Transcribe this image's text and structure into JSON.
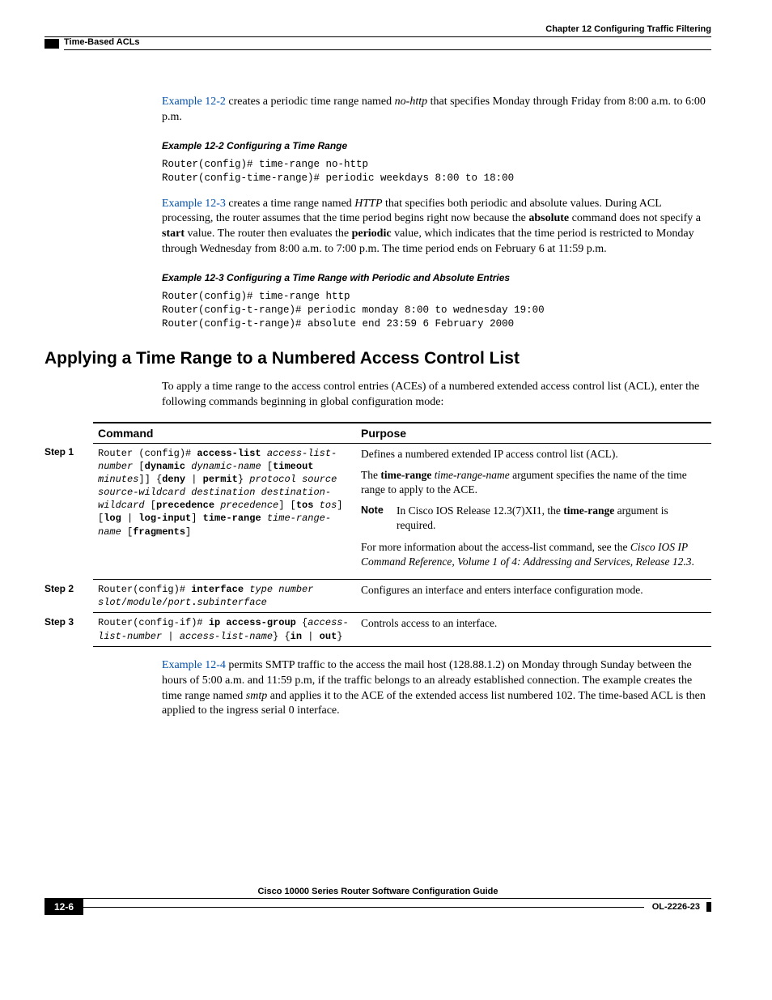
{
  "header": {
    "chapter": "Chapter 12    Configuring Traffic Filtering",
    "section": "Time-Based ACLs"
  },
  "p1": {
    "link": "Example 12-2",
    "rest_a": " creates a periodic time range named ",
    "italic": "no-http",
    "rest_b": " that specifies Monday through Friday from 8:00 a.m. to 6:00 p.m."
  },
  "ex2_title": "Example 12-2   Configuring a Time Range",
  "ex2_code": "Router(config)# time-range no-http\nRouter(config-time-range)# periodic weekdays 8:00 to 18:00",
  "p2": {
    "link": "Example 12-3",
    "rest_a": " creates a time range named ",
    "italic": "HTTP",
    "rest_b": " that specifies both periodic and absolute values. During ACL processing, the router assumes that the time period begins right now because the ",
    "b1": "absolute",
    "rest_c": " command does not specify a ",
    "b2": "start",
    "rest_d": " value. The router then evaluates the ",
    "b3": "periodic",
    "rest_e": " value, which indicates that the time period is restricted to Monday through Wednesday from 8:00 a.m. to 7:00 p.m. The time period ends on February 6 at 11:59 p.m."
  },
  "ex3_title": "Example 12-3   Configuring a Time Range with Periodic and Absolute Entries",
  "ex3_code": "Router(config)# time-range http\nRouter(config-t-range)# periodic monday 8:00 to wednesday 19:00\nRouter(config-t-range)# absolute end 23:59 6 February 2000",
  "h2": "Applying a Time Range to a Numbered Access Control List",
  "p3": "To apply a time range to the access control entries (ACEs) of a numbered extended access control list (ACL), enter the following commands beginning in global configuration mode:",
  "table": {
    "head_command": "Command",
    "head_purpose": "Purpose",
    "steps": [
      {
        "label": "Step 1",
        "purpose": {
          "p1": "Defines a numbered extended IP access control list (ACL).",
          "p2a": "The ",
          "p2b": "time-range ",
          "p2c": "time-range-name",
          "p2d": " argument specifies the name of the time range to apply to the ACE.",
          "note_label": "Note",
          "note_a": "In Cisco IOS Release 12.3(7)XI1, the ",
          "note_b": "time-range",
          "note_c": " argument is required.",
          "p3a": "For more information about the access-list command, see the ",
          "p3b": "Cisco IOS IP Command Reference, Volume 1 of 4: Addressing and Services, Release 12.3",
          "p3c": "."
        }
      },
      {
        "label": "Step 2",
        "purpose_text": "Configures an interface and enters interface configuration mode."
      },
      {
        "label": "Step 3",
        "purpose_text": "Controls access to an interface."
      }
    ]
  },
  "p4": {
    "link": "Example 12-4",
    "rest_a": " permits SMTP traffic to the access the mail host (128.88.1.2) on Monday through Sunday between the hours of 5:00 a.m. and 11:59 p.m, if the traffic belongs to an already established connection. The example creates the time range named ",
    "italic": "smtp",
    "rest_b": " and applies it to the ACE of the extended access list numbered 102. The time-based ACL is then applied to the ingress serial 0 interface."
  },
  "footer": {
    "guide": "Cisco 10000 Series Router Software Configuration Guide",
    "page": "12-6",
    "docid": "OL-2226-23"
  }
}
